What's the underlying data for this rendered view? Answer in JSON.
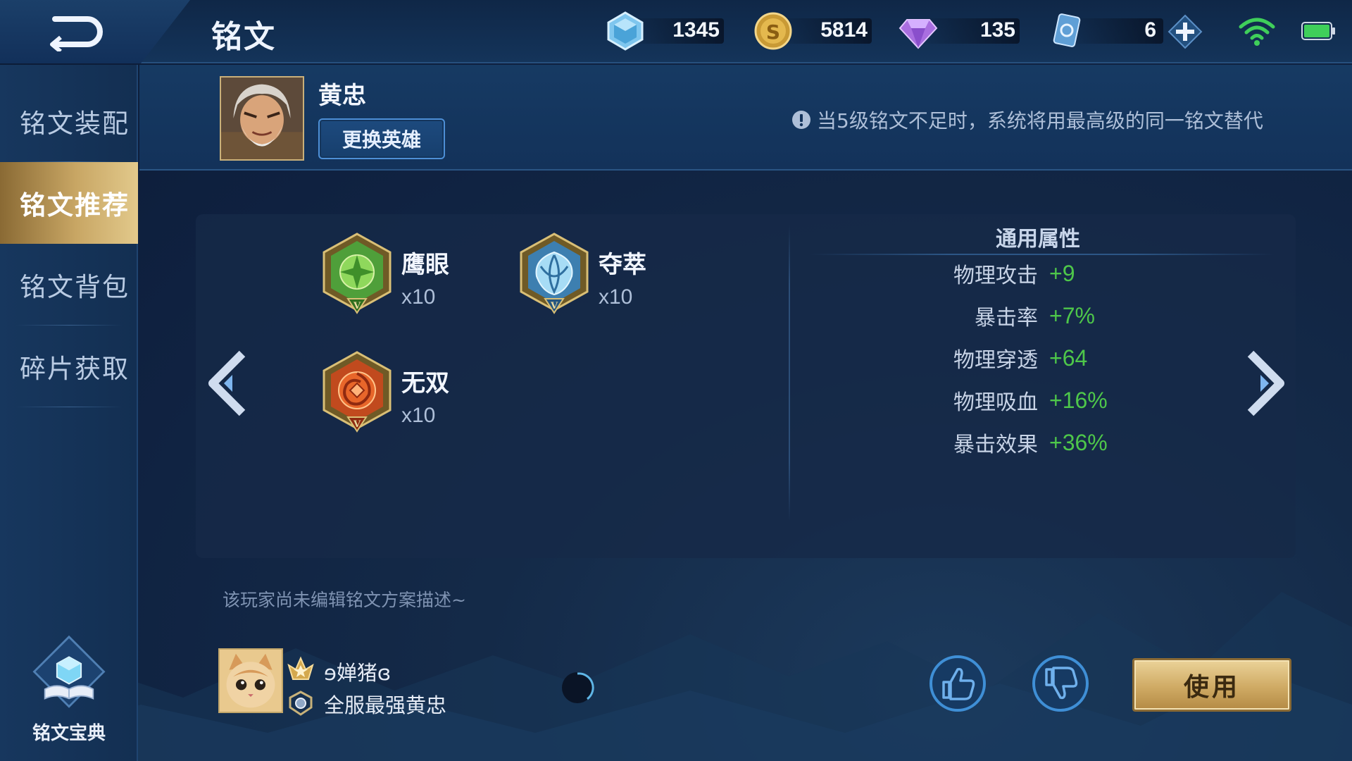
{
  "header": {
    "title": "铭文",
    "currencies": [
      {
        "icon": "diamond-crystal-icon",
        "value": "1345"
      },
      {
        "icon": "gold-coin-icon",
        "value": "5814"
      },
      {
        "icon": "gem-icon",
        "value": "135"
      },
      {
        "icon": "rune-ticket-icon",
        "value": "6"
      }
    ]
  },
  "sidebar": {
    "items": [
      {
        "label": "铭文装配",
        "active": false
      },
      {
        "label": "铭文推荐",
        "active": true
      },
      {
        "label": "铭文背包",
        "active": false
      },
      {
        "label": "碎片获取",
        "active": false
      }
    ],
    "codex_label": "铭文宝典"
  },
  "hero": {
    "name": "黄忠",
    "change_button": "更换英雄",
    "notice": "当5级铭文不足时，系统将用最高级的同一铭文替代"
  },
  "runes": [
    {
      "name": "鹰眼",
      "count": "x10",
      "color": "green"
    },
    {
      "name": "夺萃",
      "count": "x10",
      "color": "blue"
    },
    {
      "name": "无双",
      "count": "x10",
      "color": "red"
    }
  ],
  "stats": {
    "title": "通用属性",
    "rows": [
      {
        "label": "物理攻击",
        "value": "+9"
      },
      {
        "label": "暴击率",
        "value": "+7%"
      },
      {
        "label": "物理穿透",
        "value": "+64"
      },
      {
        "label": "物理吸血",
        "value": "+16%"
      },
      {
        "label": "暴击效果",
        "value": "+36%"
      }
    ]
  },
  "plan": {
    "description": "该玩家尚未编辑铭文方案描述~",
    "author_name": "ɘ婵猪ɞ",
    "author_title": "全服最强黄忠",
    "use_button": "使用"
  },
  "colors": {
    "accent_gold": "#c8a664",
    "stat_green": "#4ec74a",
    "panel_blue": "#162a48"
  }
}
